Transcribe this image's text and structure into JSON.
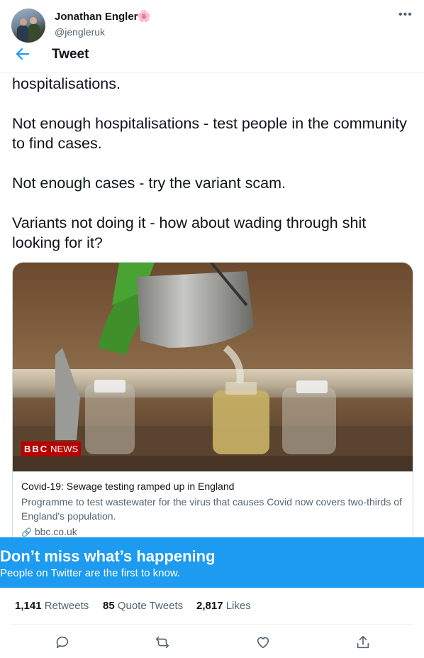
{
  "author": {
    "name": "Jonathan Engler",
    "emoji": "🌸",
    "handle": "@jengleruk"
  },
  "header": {
    "title": "Tweet"
  },
  "tweet": {
    "paragraphs": [
      "hospitalisations.",
      "Not enough hospitalisations - test people in the community to find cases.",
      "Not enough cases - try the variant scam.",
      "Variants not doing it - how about wading through shit looking for it?"
    ]
  },
  "card": {
    "logo_text": "BBC",
    "logo_suffix": "NEWS",
    "title": "Covid-19: Sewage testing ramped up in England",
    "description": "Programme to test wastewater for the virus that causes Covid now covers two-thirds of England's population.",
    "domain": "bbc.co.uk"
  },
  "banner": {
    "title": "Don’t miss what’s happening",
    "subtitle": "People on Twitter are the first to know."
  },
  "stats": {
    "retweets_count": "1,141",
    "retweets_label": "Retweets",
    "quotes_count": "85",
    "quotes_label": "Quote Tweets",
    "likes_count": "2,817",
    "likes_label": "Likes"
  },
  "colors": {
    "accent": "#1d9bf0",
    "text": "#0f1419",
    "secondary": "#536471"
  },
  "icons": [
    "back-arrow-icon",
    "more-icon",
    "link-icon",
    "reply-icon",
    "retweet-icon",
    "like-icon",
    "share-icon"
  ]
}
